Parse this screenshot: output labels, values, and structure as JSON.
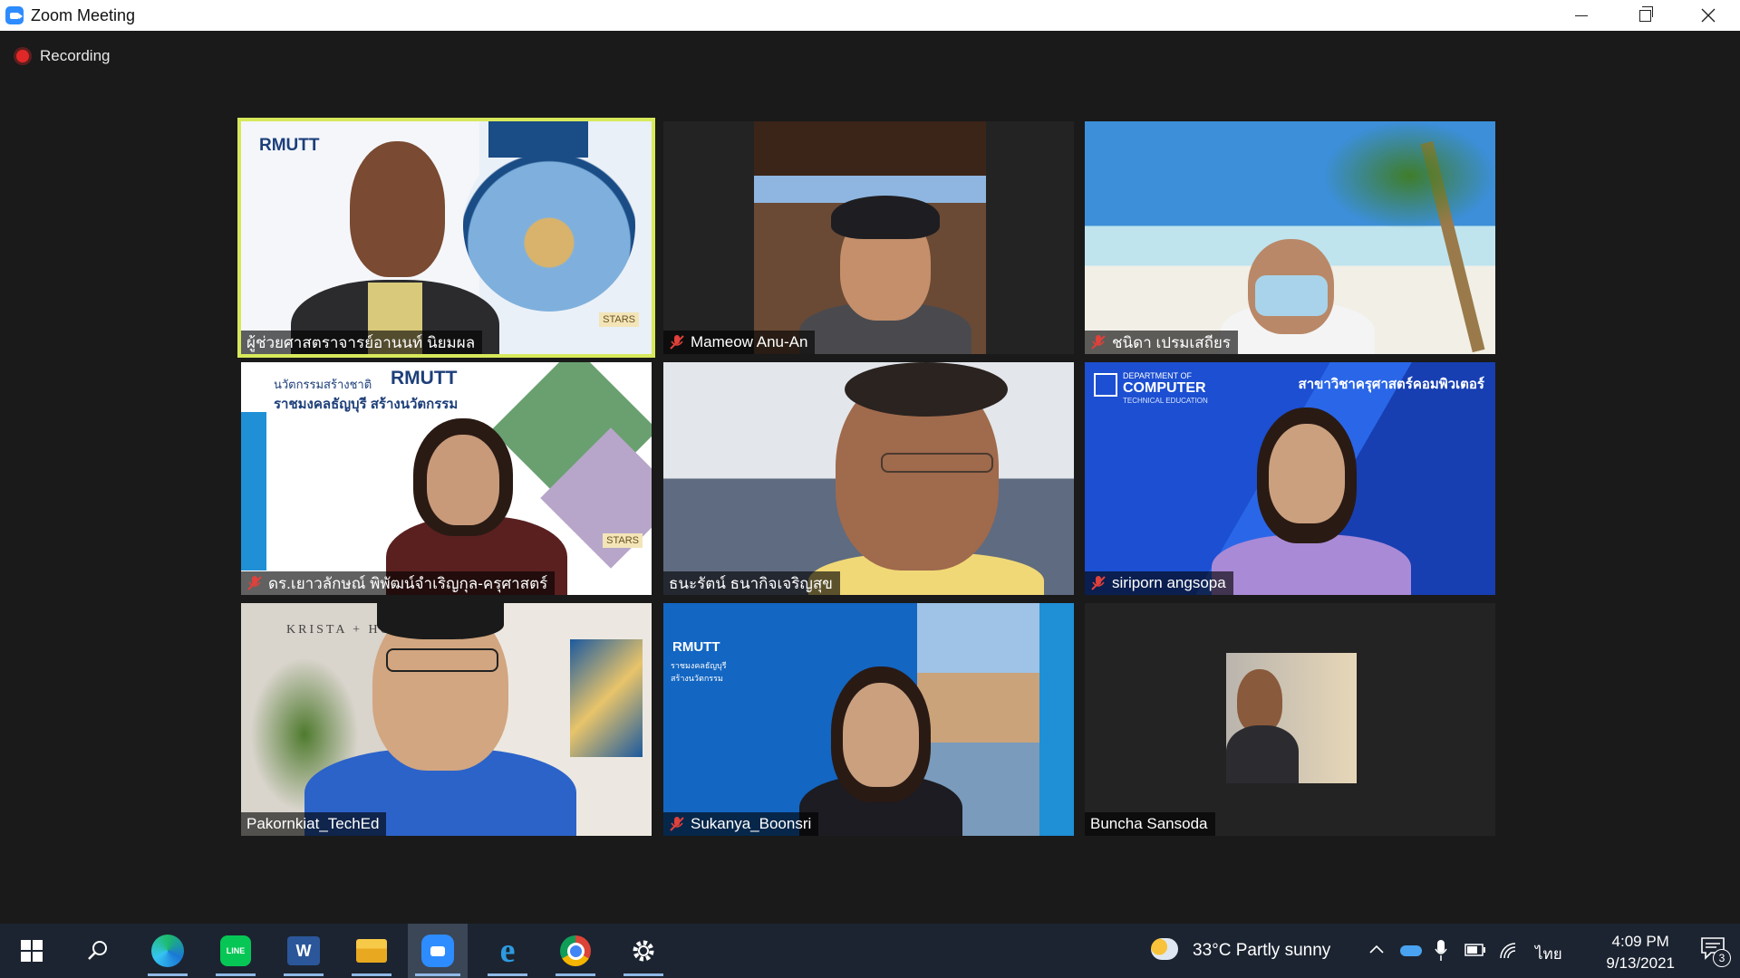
{
  "window": {
    "title": "Zoom Meeting"
  },
  "recording": {
    "label": "Recording"
  },
  "participants": [
    {
      "name": "ผู้ช่วยศาสตราจารย์อานนท์ นิยมผล",
      "muted": false,
      "active_speaker": true
    },
    {
      "name": "Mameow Anu-An",
      "muted": true,
      "active_speaker": false
    },
    {
      "name": "ชนิดา เปรมเสถียร",
      "muted": true,
      "active_speaker": false
    },
    {
      "name": "ดร.เยาวลักษณ์ พิพัฒน์จำเริญกุล-ครุศาสตร์",
      "muted": true,
      "active_speaker": false
    },
    {
      "name": "ธนะรัตน์ ธนากิจเจริญสุข",
      "muted": false,
      "active_speaker": false
    },
    {
      "name": "siriporn angsopa",
      "muted": true,
      "active_speaker": false
    },
    {
      "name": "Pakornkiat_TechEd",
      "muted": false,
      "active_speaker": false
    },
    {
      "name": "Sukanya_Boonsri",
      "muted": true,
      "active_speaker": false
    },
    {
      "name": "Buncha Sansoda",
      "muted": false,
      "active_speaker": false
    }
  ],
  "backgrounds": {
    "rmutt_logo": "RMUTT",
    "stars_badge": "STARS",
    "innovation_tagline": "นวัตกรรมสร้างชาติ",
    "university_tagline": "ราชมงคลธัญบุรี สร้างนวัตกรรม",
    "dept_line1": "DEPARTMENT OF",
    "dept_line2": "COMPUTER",
    "dept_line3": "TECHNICAL EDUCATION",
    "dept_thai": "สาขาวิชาครุศาสตร์คอมพิวเตอร์",
    "krista_sign": "KRISTA + HO"
  },
  "taskbar": {
    "apps": [
      "windows-start",
      "search",
      "edge",
      "line",
      "word",
      "file-explorer",
      "zoom",
      "internet-explorer",
      "chrome",
      "settings"
    ],
    "weather": "33°C  Partly sunny",
    "language": "ไทย",
    "time": "4:09 PM",
    "date": "9/13/2021",
    "notifications": "3"
  },
  "colors": {
    "active_speaker_border": "#d7e95b",
    "mute_red": "#e0413a",
    "zoom_blue": "#2d8cff"
  }
}
